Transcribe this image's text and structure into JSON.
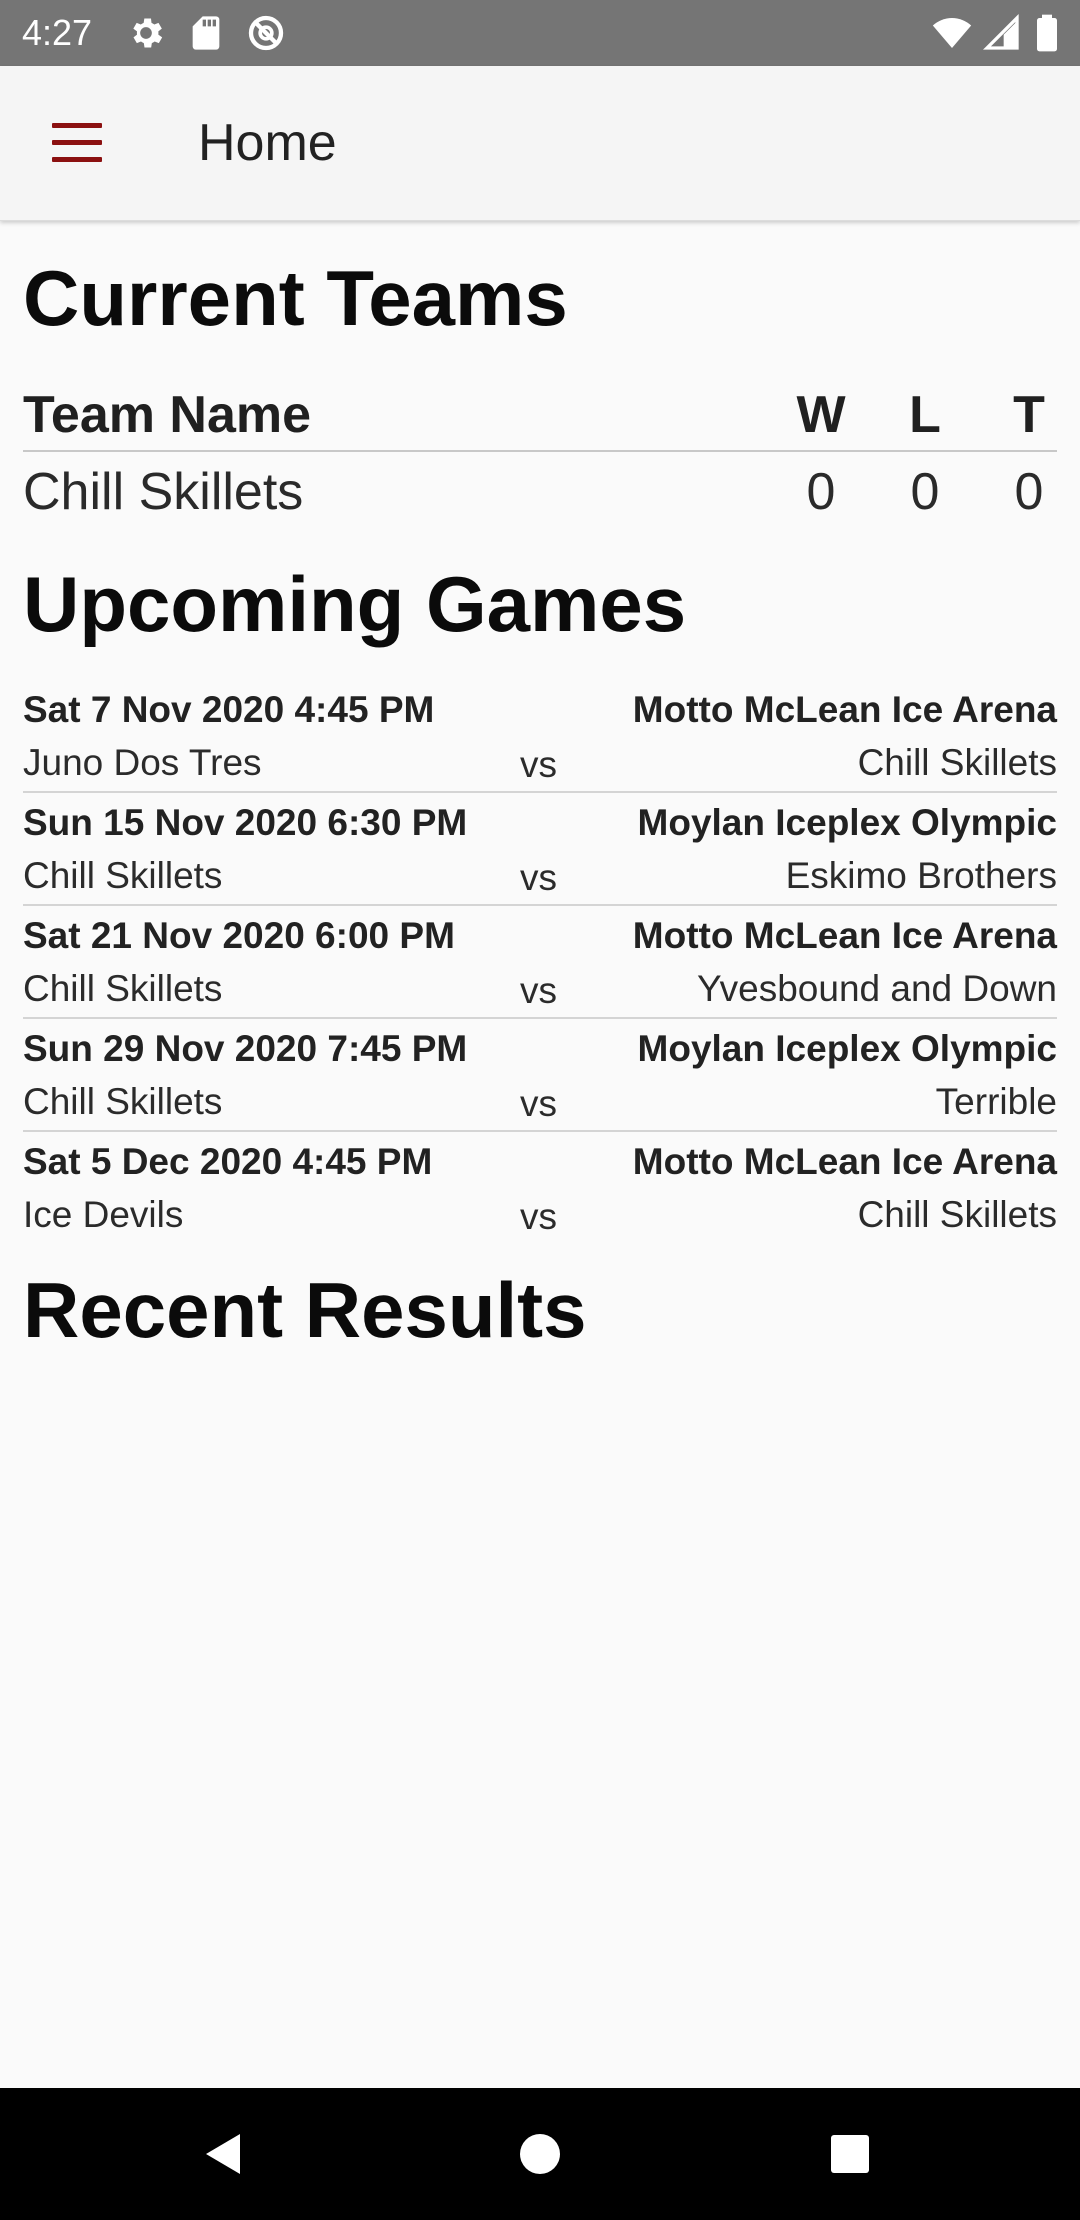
{
  "status_bar": {
    "time": "4:27",
    "icons": [
      "gear-icon",
      "sd-card-icon",
      "data-saver-icon",
      "wifi-icon",
      "signal-icon",
      "battery-icon"
    ]
  },
  "app_bar": {
    "title": "Home",
    "menu_icon": "hamburger-menu-icon",
    "accent_color": "#8b1010"
  },
  "current_teams": {
    "heading": "Current Teams",
    "columns": {
      "name": "Team Name",
      "w": "W",
      "l": "L",
      "t": "T"
    },
    "rows": [
      {
        "name": "Chill Skillets",
        "w": "0",
        "l": "0",
        "t": "0"
      }
    ]
  },
  "upcoming_games": {
    "heading": "Upcoming Games",
    "games": [
      {
        "date": "Sat 7 Nov 2020 4:45 PM",
        "venue": "Motto McLean Ice Arena",
        "home": "Juno Dos Tres",
        "vs": "vs",
        "away": "Chill Skillets"
      },
      {
        "date": "Sun 15 Nov 2020 6:30 PM",
        "venue": "Moylan Iceplex Olympic",
        "home": "Chill Skillets",
        "vs": "vs",
        "away": "Eskimo Brothers"
      },
      {
        "date": "Sat 21 Nov 2020 6:00 PM",
        "venue": "Motto McLean Ice Arena",
        "home": "Chill Skillets",
        "vs": "vs",
        "away": "Yvesbound and Down"
      },
      {
        "date": "Sun 29 Nov 2020 7:45 PM",
        "venue": "Moylan Iceplex Olympic",
        "home": "Chill Skillets",
        "vs": "vs",
        "away": "Terrible"
      },
      {
        "date": "Sat 5 Dec 2020 4:45 PM",
        "venue": "Motto McLean Ice Arena",
        "home": "Ice Devils",
        "vs": "vs",
        "away": "Chill Skillets"
      }
    ]
  },
  "recent_results": {
    "heading": "Recent Results"
  },
  "nav_bar": {
    "icons": [
      "back-icon",
      "home-icon",
      "recents-icon"
    ]
  }
}
